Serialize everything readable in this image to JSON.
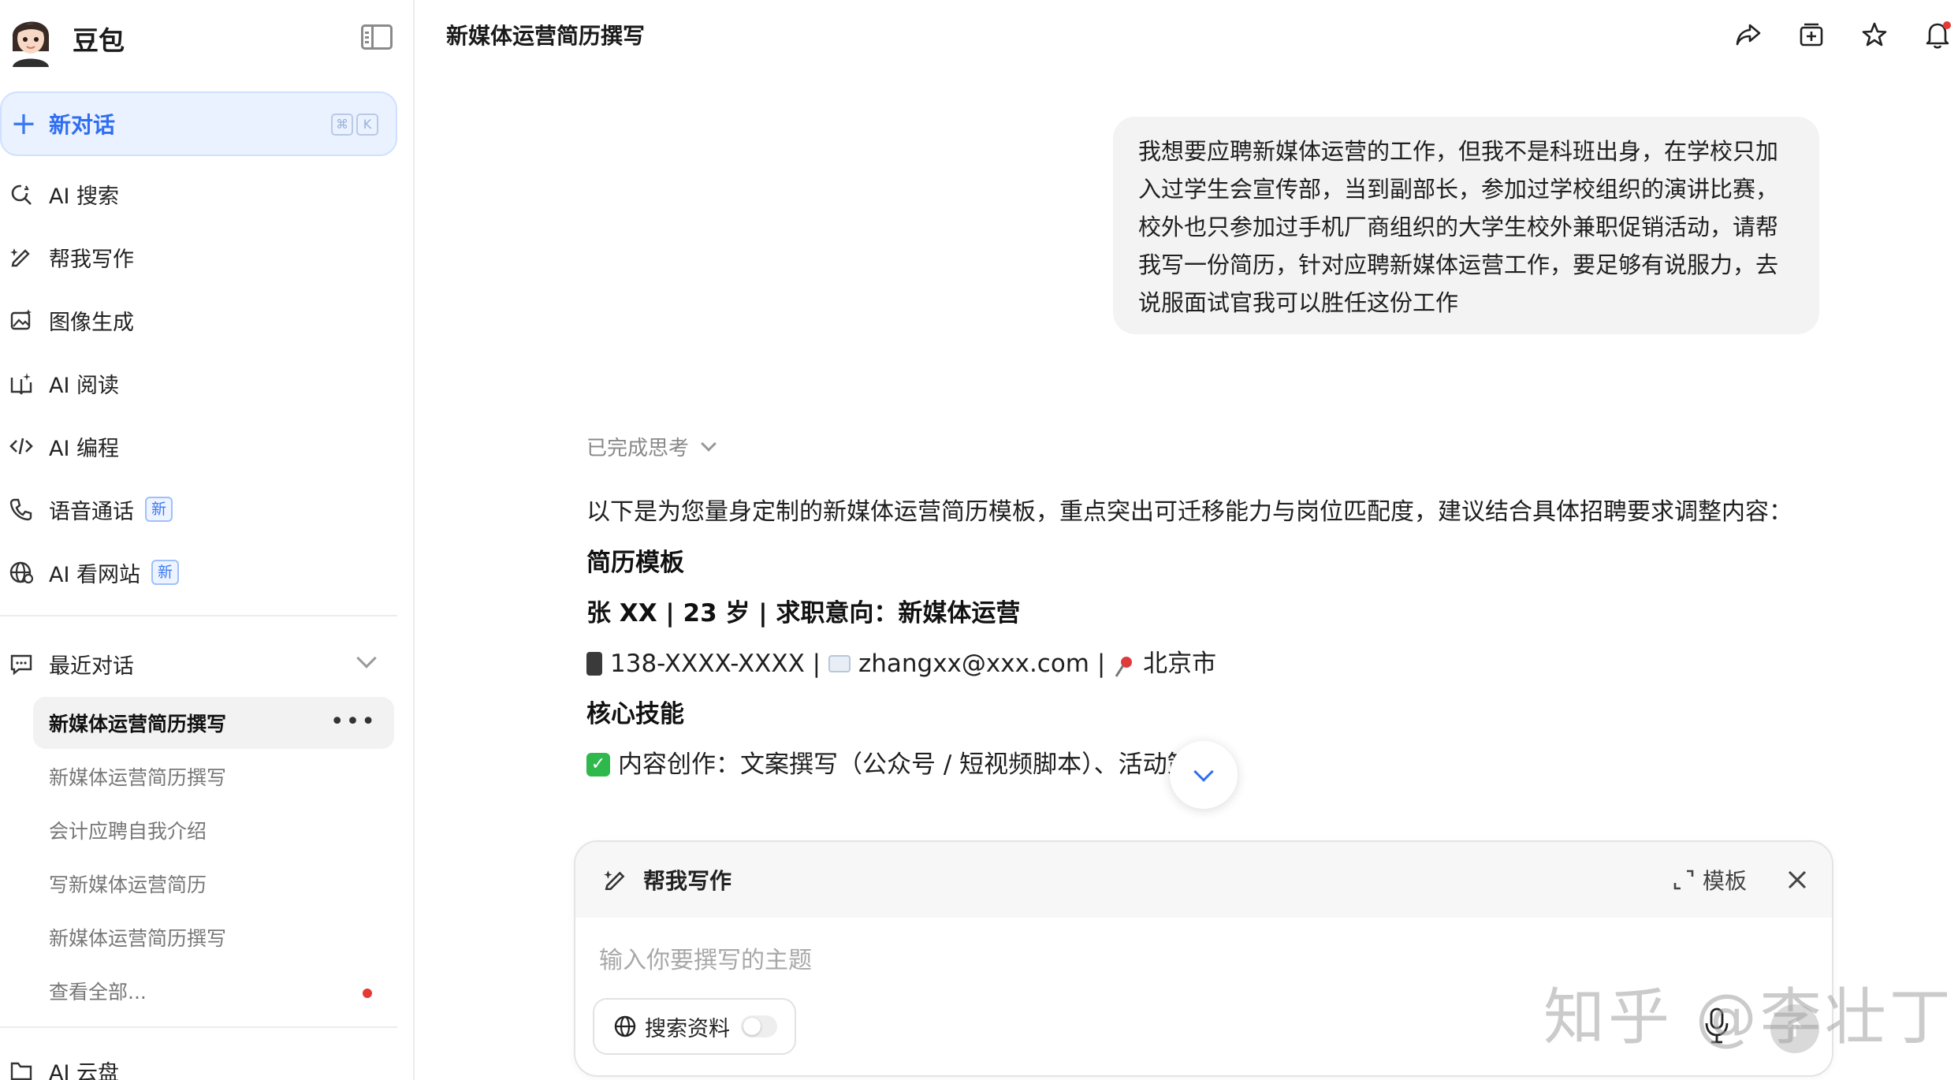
{
  "brand": {
    "name": "豆包"
  },
  "sidebar": {
    "new_chat": {
      "label": "新对话",
      "shortcut_keys": [
        "⌘",
        "K"
      ]
    },
    "nav": [
      {
        "label": "AI 搜索",
        "icon": "search-refresh-icon"
      },
      {
        "label": "帮我写作",
        "icon": "pen-sparkle-icon"
      },
      {
        "label": "图像生成",
        "icon": "image-sparkle-icon"
      },
      {
        "label": "AI 阅读",
        "icon": "book-sparkle-icon"
      },
      {
        "label": "AI 编程",
        "icon": "code-icon"
      },
      {
        "label": "语音通话",
        "icon": "phone-icon",
        "badge": "新"
      },
      {
        "label": "AI 看网站",
        "icon": "globe-icon",
        "badge": "新"
      }
    ],
    "recent": {
      "title": "最近对话",
      "items": [
        {
          "label": "新媒体运营简历撰写",
          "active": true
        },
        {
          "label": "新媒体运营简历撰写"
        },
        {
          "label": "会计应聘自我介绍"
        },
        {
          "label": "写新媒体运营简历"
        },
        {
          "label": "新媒体运营简历撰写"
        },
        {
          "label": "查看全部..."
        }
      ]
    },
    "cloud": {
      "label": "AI 云盘"
    }
  },
  "header": {
    "title": "新媒体运营简历撰写",
    "icons": [
      "share-icon",
      "add-to-collection-icon",
      "star-icon",
      "bell-icon"
    ]
  },
  "chat": {
    "user_message": "我想要应聘新媒体运营的工作，但我不是科班出身，在学校只加入过学生会宣传部，当到副部长，参加过学校组织的演讲比赛，校外也只参加过手机厂商组织的大学生校外兼职促销活动，请帮我写一份简历，针对应聘新媒体运营工作，要足够有说服力，去说服面试官我可以胜任这份工作",
    "thinking_label": "已完成思考",
    "answer": {
      "intro": "以下是为您量身定制的新媒体运营简历模板，重点突出可迁移能力与岗位匹配度，建议结合具体招聘要求调整内容：",
      "heading": "简历模板",
      "name_line": "张 XX | 23 岁 | 求职意向：新媒体运营",
      "contact": {
        "phone": "138-XXXX-XXXX",
        "sep1": " | ",
        "email": "zhangxx@xxx.com",
        "sep2": " | ",
        "city": "北京市"
      },
      "skills_heading": "核心技能",
      "skill_1": "内容创作：文案撰写（公众号 / 短视频脚本）、活动策划"
    }
  },
  "composer": {
    "mode_title": "帮我写作",
    "template_label": "模板",
    "placeholder": "输入你要撰写的主题",
    "search_toggle_label": "搜索资料",
    "search_toggle_on": false
  },
  "watermark": "知乎 @李壮丁",
  "colors": {
    "accent": "#3b7af5",
    "new_chat_bg": "#eaf2ff",
    "bubble_bg": "#f3f3f3",
    "badge_red": "#e53935"
  }
}
